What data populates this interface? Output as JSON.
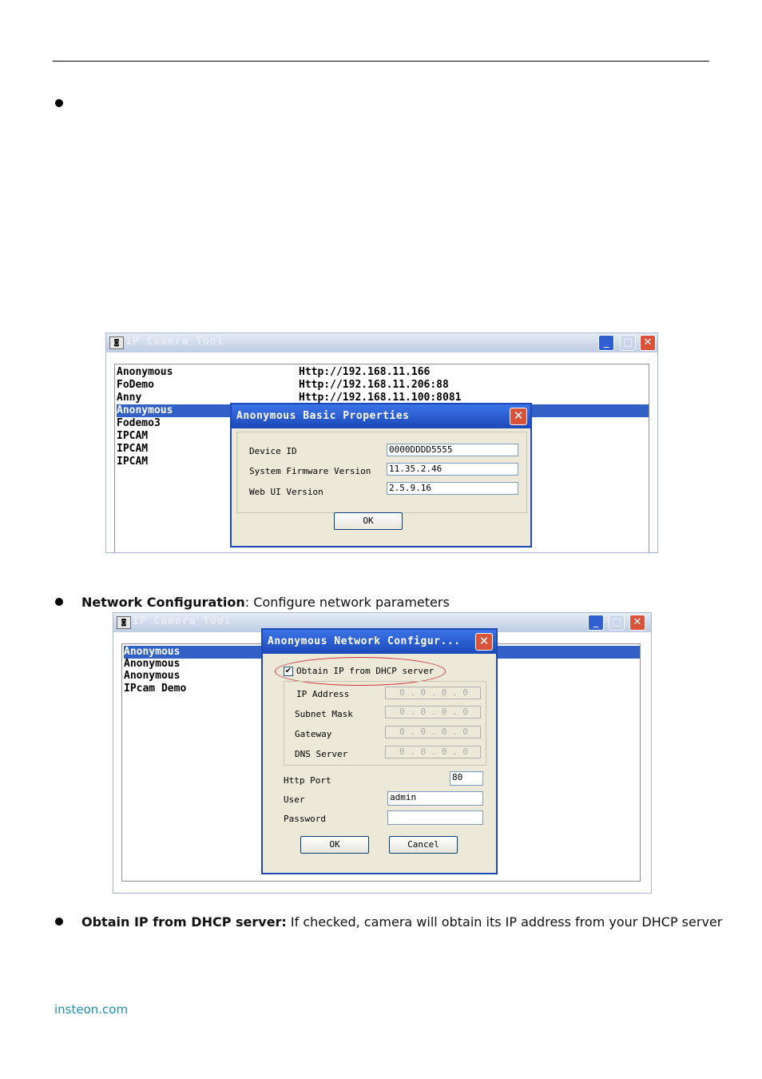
{
  "section1": {
    "ip_tool_title": "IP Camera Tool",
    "app_icon": "camera-tool-icon",
    "devices": [
      {
        "name": "Anonymous",
        "url": "Http://192.168.11.166"
      },
      {
        "name": "FoDemo",
        "url": "Http://192.168.11.206:88"
      },
      {
        "name": "Anny",
        "url": "Http://192.168.11.100:8081"
      },
      {
        "name": "Anonymous",
        "url": ""
      },
      {
        "name": "Fodemo3",
        "url": ""
      },
      {
        "name": "IPCAM",
        "url": ""
      },
      {
        "name": "IPCAM",
        "url": ""
      },
      {
        "name": "IPCAM",
        "url": ""
      }
    ],
    "dialog": {
      "title": "Anonymous Basic Properties",
      "device_id_label": "Device ID",
      "device_id_value": "0000DDDD5555",
      "firmware_label": "System Firmware Version",
      "firmware_value": "11.35.2.46",
      "webui_label": "Web UI Version",
      "webui_value": "2.5.9.16",
      "ok_label": "OK"
    }
  },
  "network_bullet": {
    "bold": "Network Configuration",
    "text": ": Configure network parameters"
  },
  "section2": {
    "ip_tool_title": "IP Camera Tool",
    "devices": [
      "Anonymous",
      "Anonymous",
      "Anonymous",
      "IPcam Demo"
    ],
    "dialog": {
      "title": "Anonymous Network Configur...",
      "dhcp_label": "Obtain IP from DHCP server",
      "dhcp_checked": "✔",
      "ip_label": "IP Address",
      "subnet_label": "Subnet Mask",
      "gateway_label": "Gateway",
      "dns_label": "DNS Server",
      "ip_placeholder": "0 . 0 . 0 . 0",
      "http_port_label": "Http Port",
      "http_port_value": "80",
      "user_label": "User",
      "user_value": "admin",
      "password_label": "Password",
      "password_value": "",
      "ok_label": "OK",
      "cancel_label": "Cancel"
    }
  },
  "dhcp_bullet": {
    "bold": "Obtain IP from DHCP server:",
    "text": " If checked, camera will obtain its IP address from your DHCP server"
  },
  "footer": "insteon.com"
}
